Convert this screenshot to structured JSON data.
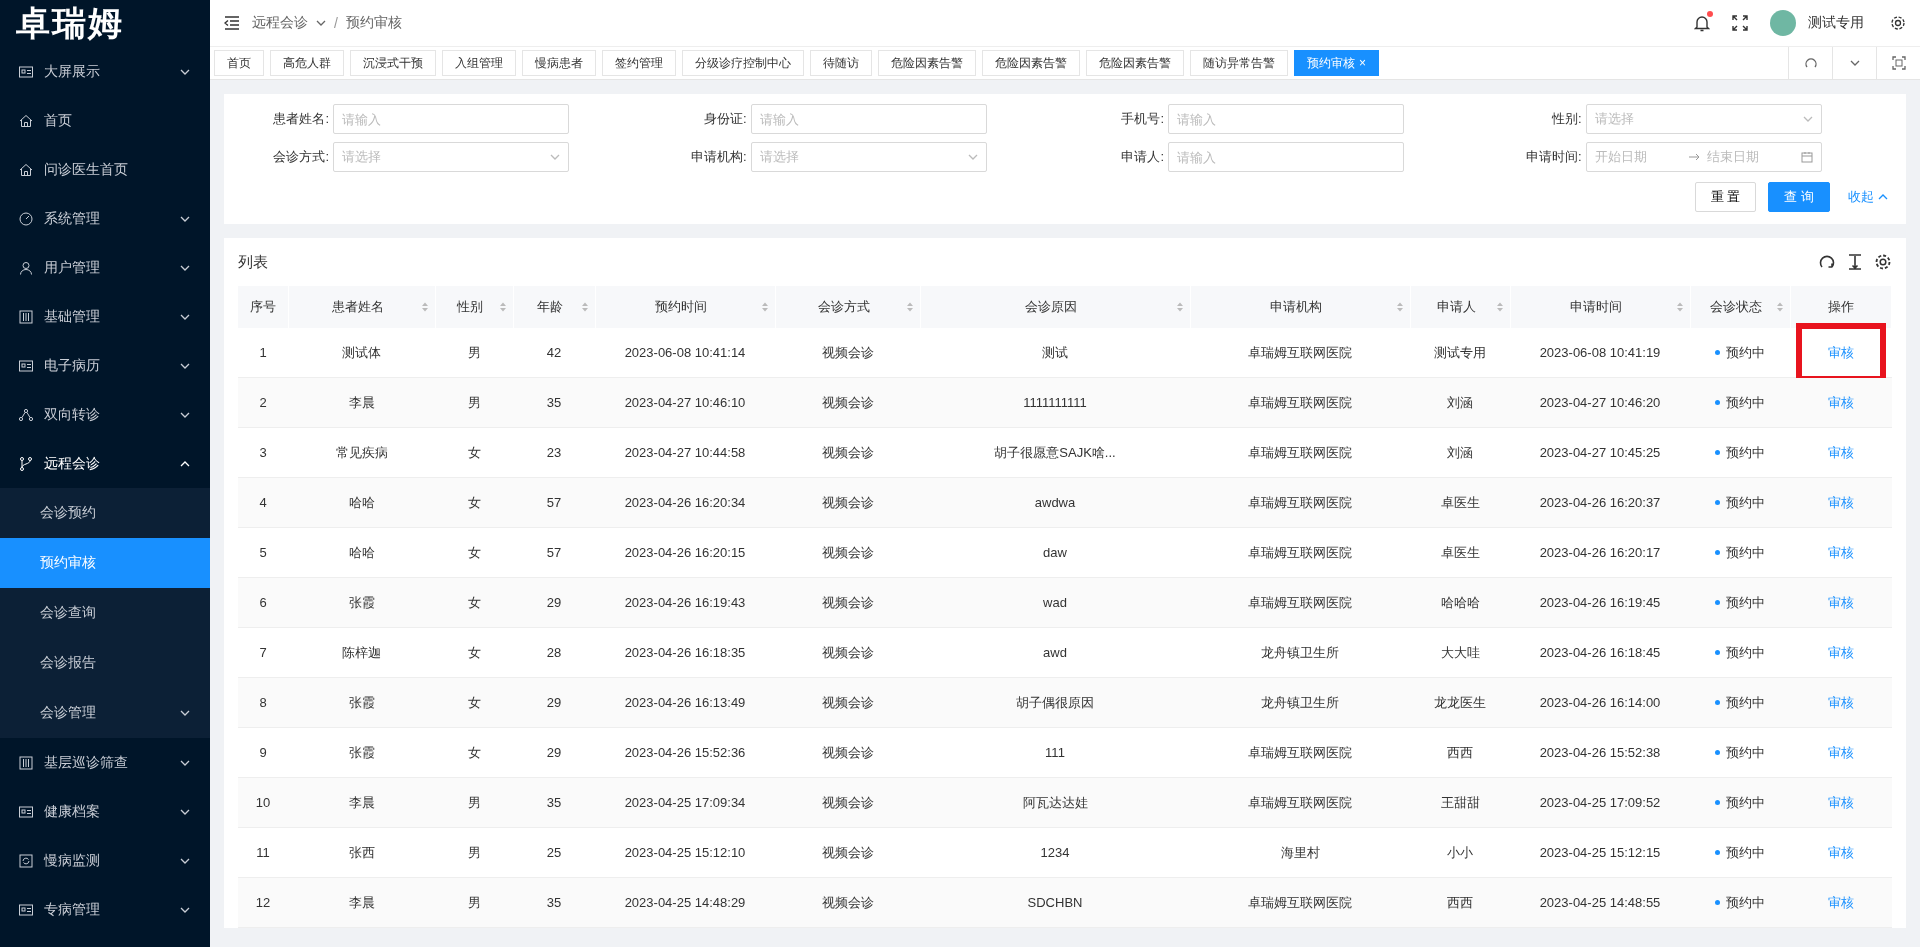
{
  "logo": "卓瑞姆",
  "sidebar": {
    "items": [
      {
        "label": "大屏展示",
        "kind": "card",
        "has_children": true,
        "expanded": false
      },
      {
        "label": "首页",
        "kind": "home",
        "has_children": false
      },
      {
        "label": "问诊医生首页",
        "kind": "home",
        "has_children": false
      },
      {
        "label": "系统管理",
        "kind": "gauge",
        "has_children": true,
        "expanded": false
      },
      {
        "label": "用户管理",
        "kind": "user",
        "has_children": true,
        "expanded": false
      },
      {
        "label": "基础管理",
        "kind": "sliders",
        "has_children": true,
        "expanded": false
      },
      {
        "label": "电子病历",
        "kind": "card",
        "has_children": true,
        "expanded": false
      },
      {
        "label": "双向转诊",
        "kind": "nodes",
        "has_children": true,
        "expanded": false
      },
      {
        "label": "远程会诊",
        "kind": "branch",
        "has_children": true,
        "expanded": true,
        "children": [
          {
            "label": "会诊预约",
            "selected": false,
            "has_children": false
          },
          {
            "label": "预约审核",
            "selected": true,
            "has_children": false
          },
          {
            "label": "会诊查询",
            "selected": false,
            "has_children": false
          },
          {
            "label": "会诊报告",
            "selected": false,
            "has_children": false
          },
          {
            "label": "会诊管理",
            "selected": false,
            "has_children": true
          }
        ]
      },
      {
        "label": "基层巡诊筛查",
        "kind": "sliders",
        "has_children": true,
        "expanded": false
      },
      {
        "label": "健康档案",
        "kind": "card",
        "has_children": true,
        "expanded": false
      },
      {
        "label": "慢病监测",
        "kind": "refresh",
        "has_children": true,
        "expanded": false
      },
      {
        "label": "专病管理",
        "kind": "card",
        "has_children": true,
        "expanded": false
      }
    ]
  },
  "header": {
    "breadcrumb": [
      "远程会诊",
      "预约审核"
    ],
    "breadcrumb_separator": "/",
    "notification_dot": true,
    "user_name": "测试专用"
  },
  "tabs": [
    {
      "label": "首页",
      "selected": false
    },
    {
      "label": "高危人群",
      "selected": false
    },
    {
      "label": "沉浸式干预",
      "selected": false
    },
    {
      "label": "入组管理",
      "selected": false
    },
    {
      "label": "慢病患者",
      "selected": false
    },
    {
      "label": "签约管理",
      "selected": false
    },
    {
      "label": "分级诊疗控制中心",
      "selected": false
    },
    {
      "label": "待随访",
      "selected": false
    },
    {
      "label": "危险因素告警",
      "selected": false
    },
    {
      "label": "危险因素告警",
      "selected": false
    },
    {
      "label": "危险因素告警",
      "selected": false
    },
    {
      "label": "随访异常告警",
      "selected": false
    },
    {
      "label": "预约审核",
      "selected": true,
      "close": "×"
    }
  ],
  "filters": [
    {
      "label": "患者姓名:",
      "kind": "input",
      "placeholder": "请输入"
    },
    {
      "label": "身份证:",
      "kind": "input",
      "placeholder": "请输入"
    },
    {
      "label": "手机号:",
      "kind": "input",
      "placeholder": "请输入"
    },
    {
      "label": "性别:",
      "kind": "select",
      "placeholder": "请选择"
    },
    {
      "label": "会诊方式:",
      "kind": "select",
      "placeholder": "请选择"
    },
    {
      "label": "申请机构:",
      "kind": "select",
      "placeholder": "请选择"
    },
    {
      "label": "申请人:",
      "kind": "input",
      "placeholder": "请输入"
    },
    {
      "label": "申请时间:",
      "kind": "daterange",
      "placeholder": "开始日期",
      "placeholder_end": "结束日期"
    }
  ],
  "filter_buttons": {
    "reset": "重 置",
    "search": "查 询",
    "collapse": "收起"
  },
  "table": {
    "title": "列表",
    "columns": [
      {
        "label": "序号",
        "sortable": false
      },
      {
        "label": "患者姓名",
        "sortable": true
      },
      {
        "label": "性别",
        "sortable": true
      },
      {
        "label": "年龄",
        "sortable": true
      },
      {
        "label": "预约时间",
        "sortable": true
      },
      {
        "label": "会诊方式",
        "sortable": true
      },
      {
        "label": "会诊原因",
        "sortable": true
      },
      {
        "label": "申请机构",
        "sortable": true
      },
      {
        "label": "申请人",
        "sortable": true
      },
      {
        "label": "申请时间",
        "sortable": true
      },
      {
        "label": "会诊状态",
        "sortable": true
      },
      {
        "label": "操作",
        "sortable": false
      }
    ],
    "rows": [
      {
        "cells": [
          "1",
          "测试体",
          "男",
          "42",
          "2023-06-08 10:41:14",
          "视频会诊",
          "测试",
          "卓瑞姆互联网医院",
          "测试专用",
          "2023-06-08 10:41:19",
          "预约中"
        ],
        "action": "审核",
        "highlighted": true
      },
      {
        "cells": [
          "2",
          "李晨",
          "男",
          "35",
          "2023-04-27 10:46:10",
          "视频会诊",
          "1111111111",
          "卓瑞姆互联网医院",
          "刘涵",
          "2023-04-27 10:46:20",
          "预约中"
        ],
        "action": "审核",
        "highlighted": false
      },
      {
        "cells": [
          "3",
          "常见疾病",
          "女",
          "23",
          "2023-04-27 10:44:58",
          "视频会诊",
          "胡子很愿意SAJK啥...",
          "卓瑞姆互联网医院",
          "刘涵",
          "2023-04-27 10:45:25",
          "预约中"
        ],
        "action": "审核",
        "highlighted": false
      },
      {
        "cells": [
          "4",
          "哈哈",
          "女",
          "57",
          "2023-04-26 16:20:34",
          "视频会诊",
          "awdwa",
          "卓瑞姆互联网医院",
          "卓医生",
          "2023-04-26 16:20:37",
          "预约中"
        ],
        "action": "审核",
        "highlighted": false
      },
      {
        "cells": [
          "5",
          "哈哈",
          "女",
          "57",
          "2023-04-26 16:20:15",
          "视频会诊",
          "daw",
          "卓瑞姆互联网医院",
          "卓医生",
          "2023-04-26 16:20:17",
          "预约中"
        ],
        "action": "审核",
        "highlighted": false
      },
      {
        "cells": [
          "6",
          "张霞",
          "女",
          "29",
          "2023-04-26 16:19:43",
          "视频会诊",
          "wad",
          "卓瑞姆互联网医院",
          "哈哈哈",
          "2023-04-26 16:19:45",
          "预约中"
        ],
        "action": "审核",
        "highlighted": false
      },
      {
        "cells": [
          "7",
          "陈梓迦",
          "女",
          "28",
          "2023-04-26 16:18:35",
          "视频会诊",
          "awd",
          "龙舟镇卫生所",
          "大大哇",
          "2023-04-26 16:18:45",
          "预约中"
        ],
        "action": "审核",
        "highlighted": false
      },
      {
        "cells": [
          "8",
          "张霞",
          "女",
          "29",
          "2023-04-26 16:13:49",
          "视频会诊",
          "胡子偶很原因",
          "龙舟镇卫生所",
          "龙龙医生",
          "2023-04-26 16:14:00",
          "预约中"
        ],
        "action": "审核",
        "highlighted": false
      },
      {
        "cells": [
          "9",
          "张霞",
          "女",
          "29",
          "2023-04-26 15:52:36",
          "视频会诊",
          "111",
          "卓瑞姆互联网医院",
          "西西",
          "2023-04-26 15:52:38",
          "预约中"
        ],
        "action": "审核",
        "highlighted": false
      },
      {
        "cells": [
          "10",
          "李晨",
          "男",
          "35",
          "2023-04-25 17:09:34",
          "视频会诊",
          "阿瓦达达娃",
          "卓瑞姆互联网医院",
          "王甜甜",
          "2023-04-25 17:09:52",
          "预约中"
        ],
        "action": "审核",
        "highlighted": false
      },
      {
        "cells": [
          "11",
          "张西",
          "男",
          "25",
          "2023-04-25 15:12:10",
          "视频会诊",
          "1234",
          "海里村",
          "小小",
          "2023-04-25 15:12:15",
          "预约中"
        ],
        "action": "审核",
        "highlighted": false
      },
      {
        "cells": [
          "12",
          "李晨",
          "男",
          "35",
          "2023-04-25 14:48:29",
          "视频会诊",
          "SDCHBN",
          "卓瑞姆互联网医院",
          "西西",
          "2023-04-25 14:48:55",
          "预约中"
        ],
        "action": "审核",
        "highlighted": false
      }
    ]
  }
}
